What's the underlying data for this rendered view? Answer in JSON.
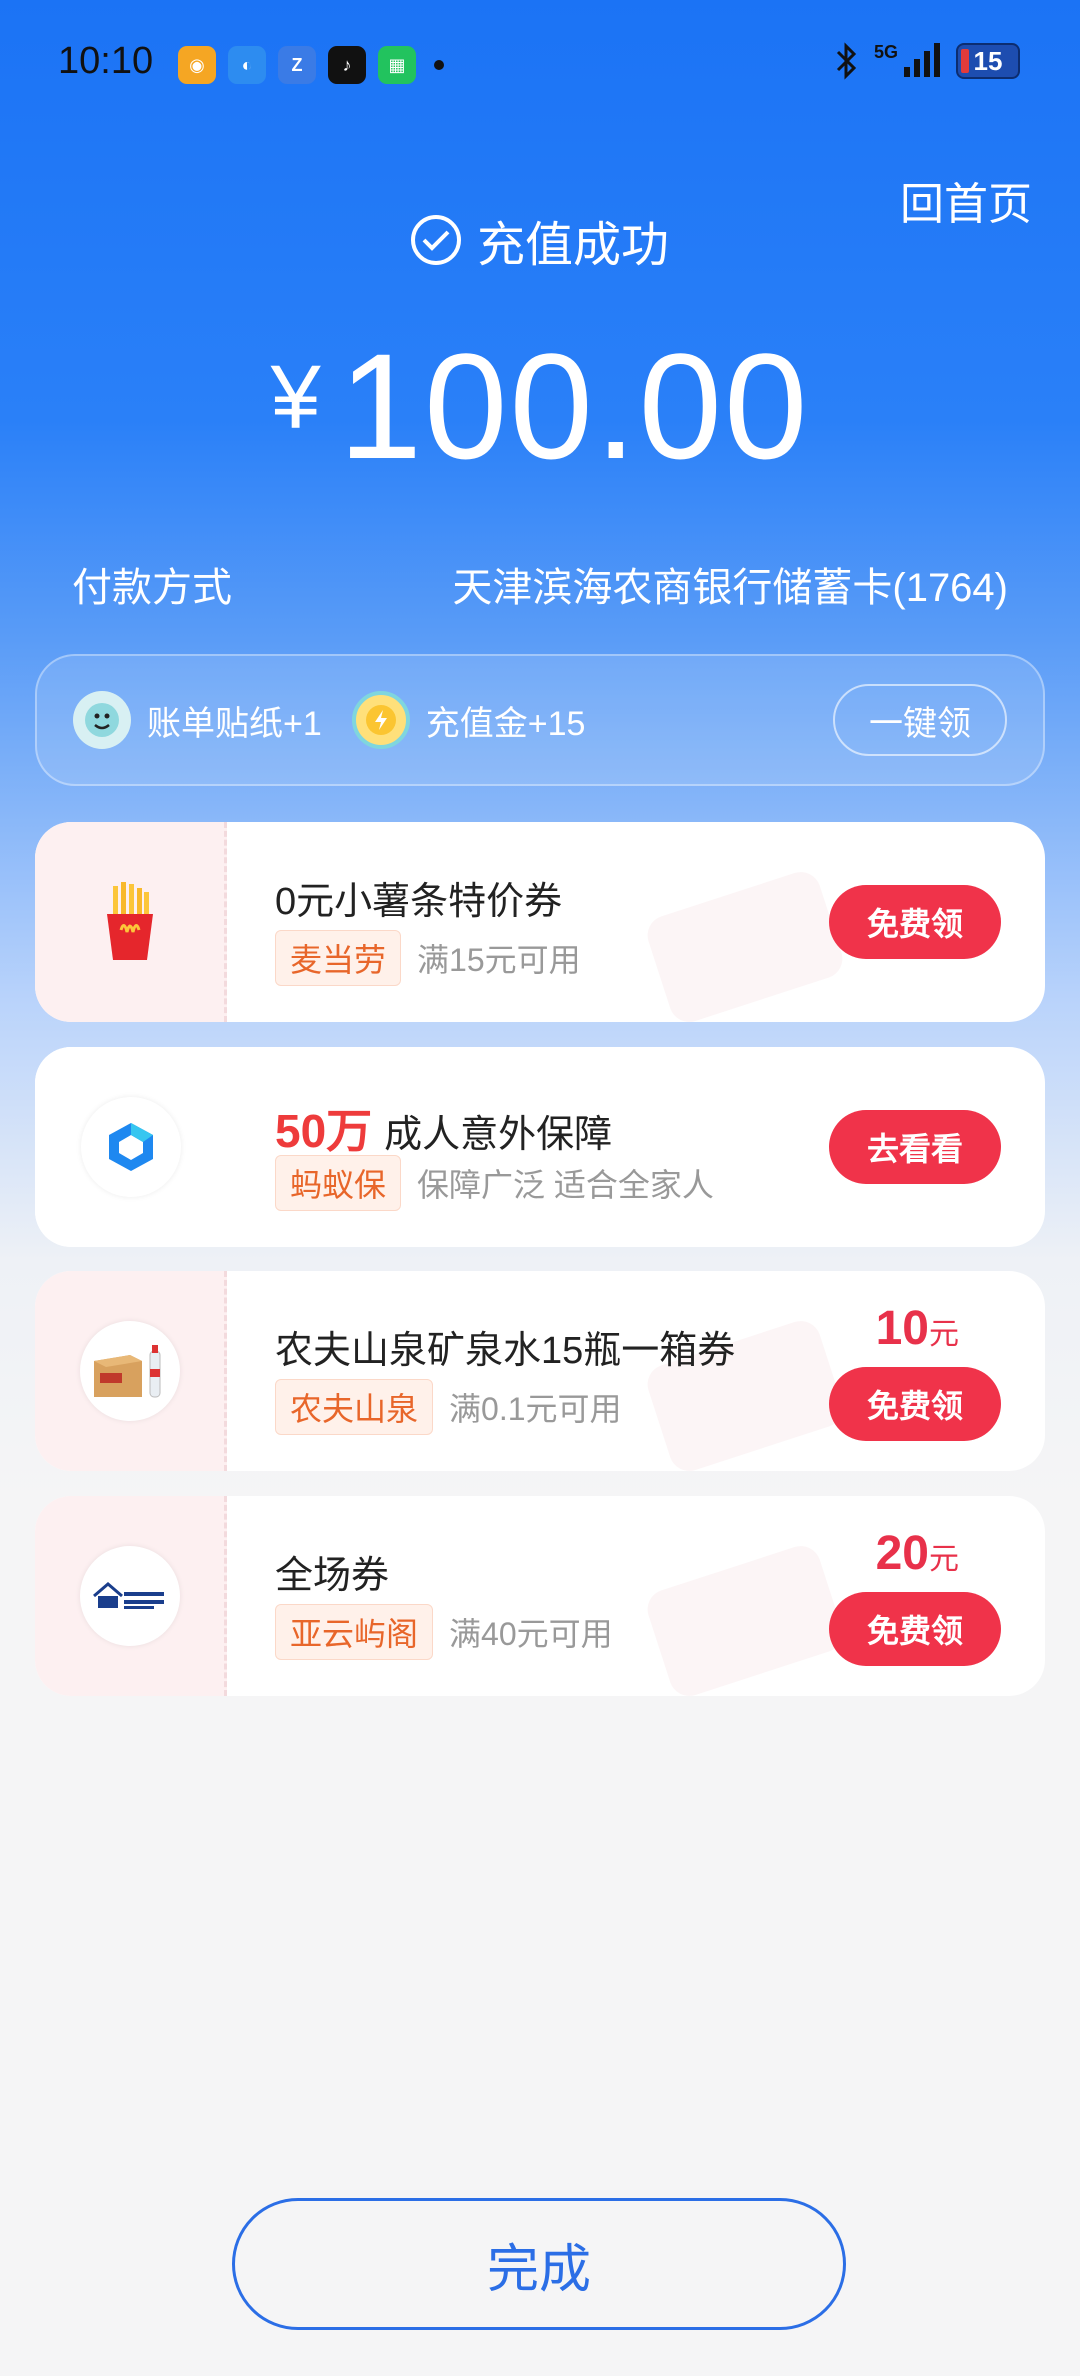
{
  "status_bar": {
    "time": "10:10",
    "battery": "15",
    "network": "5G"
  },
  "header": {
    "home_link": "回首页",
    "success_text": "充值成功",
    "currency": "¥",
    "amount": "100.00"
  },
  "payment": {
    "label": "付款方式",
    "method": "天津滨海农商银行储蓄卡(1764)"
  },
  "rewards": {
    "items": [
      {
        "text": "账单贴纸+1",
        "icon": "sticker-icon"
      },
      {
        "text": "充值金+15",
        "icon": "coin-icon"
      }
    ],
    "claim_all": "一键领"
  },
  "offers": [
    {
      "title": "0元小薯条特价券",
      "brand": "麦当劳",
      "condition": "满15元可用",
      "button": "免费领",
      "logo": "mcdonalds-fries-logo"
    },
    {
      "highlight": "50万",
      "title": "成人意外保障",
      "brand": "蚂蚁保",
      "condition": "保障广泛 适合全家人",
      "button": "去看看",
      "logo": "ant-insurance-logo"
    },
    {
      "title": "农夫山泉矿泉水15瓶一箱券",
      "brand": "农夫山泉",
      "condition": "满0.1元可用",
      "price": "10",
      "price_unit": "元",
      "button": "免费领",
      "logo": "water-box-logo"
    },
    {
      "title": "全场券",
      "brand": "亚云屿阁",
      "condition": "满40元可用",
      "price": "20",
      "price_unit": "元",
      "button": "免费领",
      "logo": "yayunyuge-logo"
    }
  ],
  "footer": {
    "done": "完成"
  }
}
